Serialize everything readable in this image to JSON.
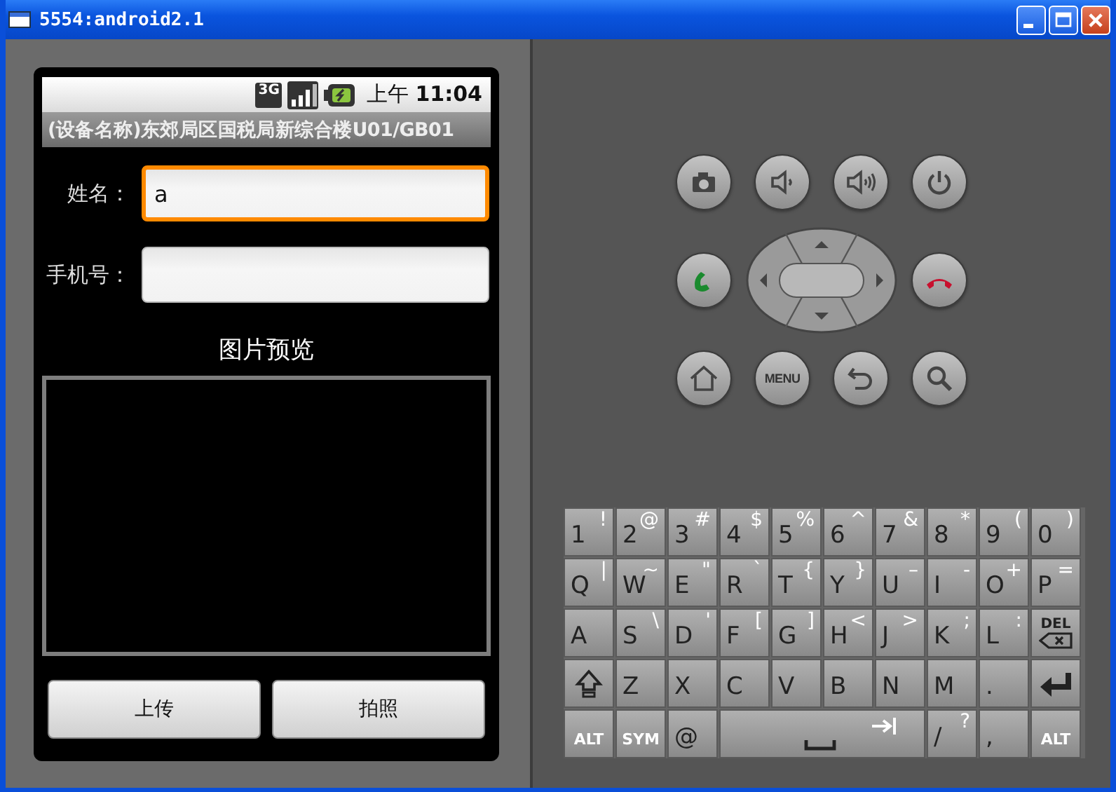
{
  "window": {
    "title": "5554:android2.1"
  },
  "status_bar": {
    "network": "3G",
    "time": "上午 **11:04**"
  },
  "app_title": "(设备名称)东郊局区国税局新综合楼U01/GB01",
  "form": [
    {
      "label": "姓名：",
      "value": "a",
      "focused": true
    },
    {
      "label": "手机号：",
      "focused": false
    }
  ],
  "preview": {
    "title": "图片预览"
  },
  "buttons": [
    "上传",
    "拍照"
  ],
  "hardware_keys": [
    {
      "kind": "camera"
    },
    {
      "kind": "volume-down"
    },
    {
      "kind": "volume-up"
    },
    {
      "kind": "power"
    },
    {
      "kind": "call"
    },
    {
      "kind": "dpad"
    },
    {
      "kind": "end-call"
    },
    {
      "kind": "home"
    },
    {
      "kind": "menu",
      "label": "MENU"
    },
    {
      "kind": "back"
    },
    {
      "kind": "search"
    }
  ],
  "keyboard": [
    [
      {
        "kind": "char",
        "main": "1",
        "alt": "!"
      },
      {
        "kind": "char",
        "main": "2",
        "alt": "@"
      },
      {
        "kind": "char",
        "main": "3",
        "alt": "#"
      },
      {
        "kind": "char",
        "main": "4",
        "alt": "$"
      },
      {
        "kind": "char",
        "main": "5",
        "alt": "%"
      },
      {
        "kind": "char",
        "main": "6",
        "alt": "^"
      },
      {
        "kind": "char",
        "main": "7",
        "alt": "&"
      },
      {
        "kind": "char",
        "main": "8",
        "alt": "*"
      },
      {
        "kind": "char",
        "main": "9",
        "alt": "("
      },
      {
        "kind": "char",
        "main": "0",
        "alt": ")"
      }
    ],
    [
      {
        "kind": "char",
        "main": "Q",
        "alt": "|"
      },
      {
        "kind": "char",
        "main": "W",
        "alt": "~"
      },
      {
        "kind": "char",
        "main": "E",
        "alt": "\""
      },
      {
        "kind": "char",
        "main": "R",
        "alt": "`"
      },
      {
        "kind": "char",
        "main": "T",
        "alt": "{"
      },
      {
        "kind": "char",
        "main": "Y",
        "alt": "}"
      },
      {
        "kind": "char",
        "main": "U",
        "alt": "–"
      },
      {
        "kind": "char",
        "main": "I",
        "alt": "-"
      },
      {
        "kind": "char",
        "main": "O",
        "alt": "+"
      },
      {
        "kind": "char",
        "main": "P",
        "alt": "="
      }
    ],
    [
      {
        "kind": "char",
        "main": "A"
      },
      {
        "kind": "char",
        "main": "S",
        "alt": "\\"
      },
      {
        "kind": "char",
        "main": "D",
        "alt": "'"
      },
      {
        "kind": "char",
        "main": "F",
        "alt": "["
      },
      {
        "kind": "char",
        "main": "G",
        "alt": "]"
      },
      {
        "kind": "char",
        "main": "H",
        "alt": "<"
      },
      {
        "kind": "char",
        "main": "J",
        "alt": ">"
      },
      {
        "kind": "char",
        "main": "K",
        "alt": ";"
      },
      {
        "kind": "char",
        "main": "L",
        "alt": ":"
      },
      {
        "kind": "del",
        "main": "DEL"
      }
    ],
    [
      {
        "kind": "shift"
      },
      {
        "kind": "char",
        "main": "Z"
      },
      {
        "kind": "char",
        "main": "X"
      },
      {
        "kind": "char",
        "main": "C"
      },
      {
        "kind": "char",
        "main": "V"
      },
      {
        "kind": "char",
        "main": "B"
      },
      {
        "kind": "char",
        "main": "N"
      },
      {
        "kind": "char",
        "main": "M"
      },
      {
        "kind": "char",
        "main": "."
      },
      {
        "kind": "enter"
      }
    ],
    [
      {
        "kind": "mod",
        "main": "ALT"
      },
      {
        "kind": "mod",
        "main": "SYM"
      },
      {
        "kind": "char",
        "main": "@"
      },
      {
        "kind": "space"
      },
      {
        "kind": "char",
        "main": "/",
        "alt": "?"
      },
      {
        "kind": "char",
        "main": ","
      },
      {
        "kind": "mod",
        "main": "ALT"
      }
    ]
  ]
}
